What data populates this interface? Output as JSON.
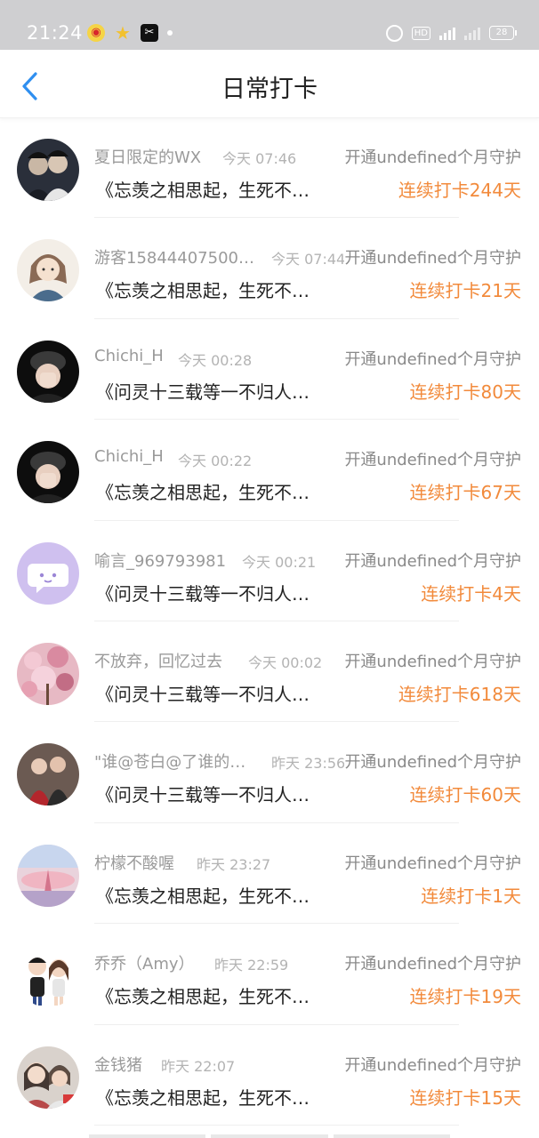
{
  "status_bar": {
    "time": "21:24",
    "hd": "HD",
    "network": "4G",
    "battery": "28"
  },
  "nav": {
    "title": "日常打卡",
    "back_icon": "chevron-left-icon"
  },
  "colors": {
    "accent": "#f28a3b",
    "back_icon": "#2f8ff0"
  },
  "checkins": [
    {
      "username": "夏日限定的WX",
      "time": "今天 07:46",
      "guard": "开通undefined个月守护",
      "book": "《忘羡之相思起，生死不…",
      "streak": "连续打卡244天"
    },
    {
      "username": "游客15844407500…",
      "time": "今天 07:44",
      "guard": "开通undefined个月守护",
      "book": "《忘羡之相思起，生死不…",
      "streak": "连续打卡21天"
    },
    {
      "username": "Chichi_H",
      "time": "今天 00:28",
      "guard": "开通undefined个月守护",
      "book": "《问灵十三载等一不归人…",
      "streak": "连续打卡80天"
    },
    {
      "username": "Chichi_H",
      "time": "今天 00:22",
      "guard": "开通undefined个月守护",
      "book": "《忘羡之相思起，生死不…",
      "streak": "连续打卡67天"
    },
    {
      "username": "喻言_969793981",
      "time": "今天 00:21",
      "guard": "开通undefined个月守护",
      "book": "《问灵十三载等一不归人…",
      "streak": "连续打卡4天"
    },
    {
      "username": "不放弃，回忆过去",
      "time": "今天 00:02",
      "guard": "开通undefined个月守护",
      "book": "《问灵十三载等一不归人…",
      "streak": "连续打卡618天"
    },
    {
      "username": "\"谁@苍白@了谁的…",
      "time": "昨天 23:56",
      "guard": "开通undefined个月守护",
      "book": "《问灵十三载等一不归人…",
      "streak": "连续打卡60天"
    },
    {
      "username": "柠檬不酸喔",
      "time": "昨天 23:27",
      "guard": "开通undefined个月守护",
      "book": "《忘羡之相思起，生死不…",
      "streak": "连续打卡1天"
    },
    {
      "username": "乔乔（Amy）",
      "time": "昨天 22:59",
      "guard": "开通undefined个月守护",
      "book": "《忘羡之相思起，生死不…",
      "streak": "连续打卡19天"
    },
    {
      "username": "金钱猪",
      "time": "昨天 22:07",
      "guard": "开通undefined个月守护",
      "book": "《忘羡之相思起，生死不…",
      "streak": "连续打卡15天"
    }
  ]
}
